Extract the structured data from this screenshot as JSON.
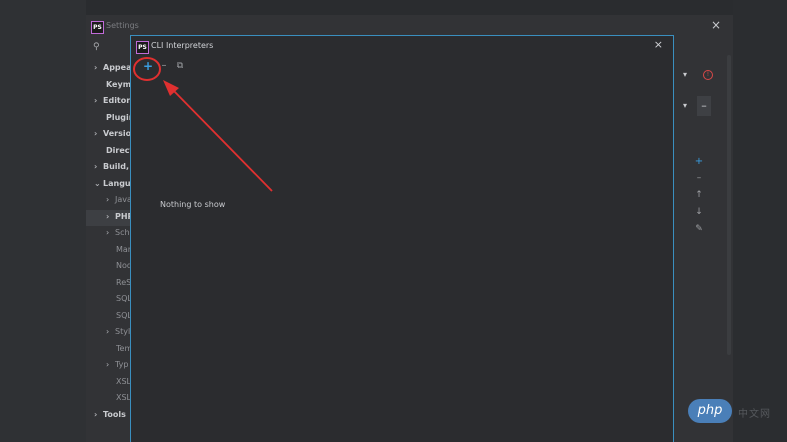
{
  "settings": {
    "title": "Settings",
    "close_glyph": "×",
    "search_icon_glyph": "⚲",
    "tree": [
      {
        "label": "Appea",
        "chevron": "›",
        "bold": true
      },
      {
        "label": "Keyma",
        "chevron": "",
        "bold": true
      },
      {
        "label": "Editor",
        "chevron": "›",
        "bold": true
      },
      {
        "label": "Plugin",
        "chevron": "",
        "bold": true
      },
      {
        "label": "Versio",
        "chevron": "›",
        "bold": true
      },
      {
        "label": "Direct",
        "chevron": "",
        "bold": true
      },
      {
        "label": "Build,",
        "chevron": "›",
        "bold": true
      },
      {
        "label": "Langu",
        "chevron": "⌄",
        "bold": true
      },
      {
        "label": "Java",
        "chevron": "›",
        "bold": false
      },
      {
        "label": "PHP",
        "chevron": "›",
        "bold": true
      },
      {
        "label": "Sche",
        "chevron": "›",
        "bold": false
      },
      {
        "label": "Mar",
        "chevron": "",
        "bold": false
      },
      {
        "label": "Nod",
        "chevron": "",
        "bold": false
      },
      {
        "label": "ReS",
        "chevron": "",
        "bold": false
      },
      {
        "label": "SQL",
        "chevron": "",
        "bold": false
      },
      {
        "label": "SQL",
        "chevron": "",
        "bold": false
      },
      {
        "label": "Style",
        "chevron": "›",
        "bold": false
      },
      {
        "label": "Tem",
        "chevron": "",
        "bold": false
      },
      {
        "label": "Typ",
        "chevron": "›",
        "bold": false
      },
      {
        "label": "XSL",
        "chevron": "",
        "bold": false
      },
      {
        "label": "XSL",
        "chevron": "",
        "bold": false
      },
      {
        "label": "Tools",
        "chevron": "›",
        "bold": true
      }
    ],
    "right": {
      "dropdown_arrow": "▾",
      "warning_glyph": "!",
      "minus_glyph": "–",
      "side_buttons": [
        "+",
        "–",
        "↑",
        "↓",
        "✎"
      ]
    }
  },
  "dialog": {
    "title": "CLI Interpreters",
    "close_glyph": "×",
    "toolbar": {
      "add": "+",
      "remove": "–",
      "copy": "⧉"
    },
    "empty_text": "Nothing to show"
  },
  "watermark": {
    "badge": "php",
    "text": "中文网"
  },
  "colors": {
    "accent": "#3a9de0",
    "annotation": "#e03030",
    "dialog_border": "#3a8fbf"
  }
}
